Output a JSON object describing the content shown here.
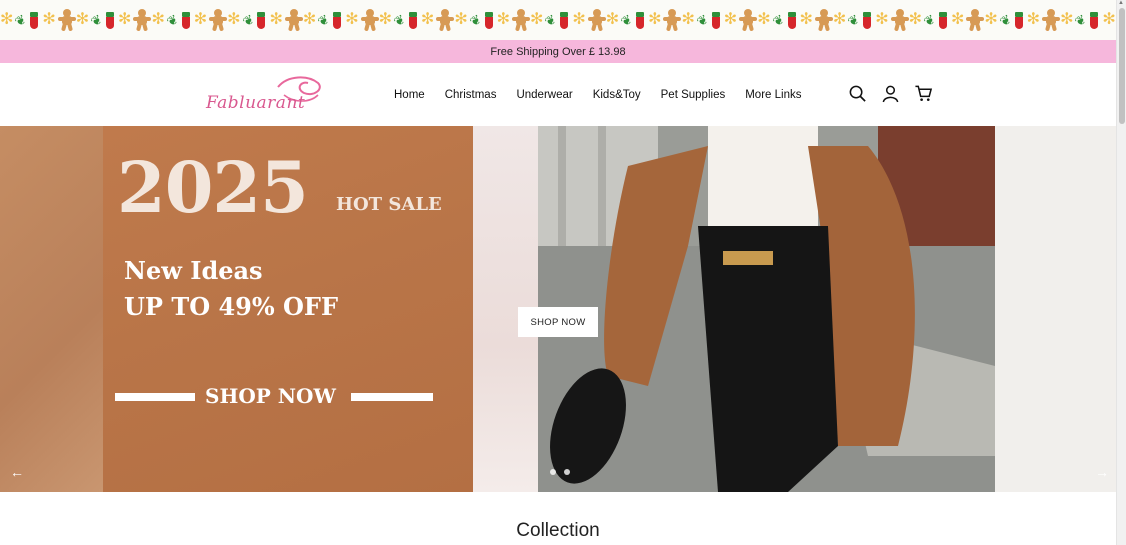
{
  "announcement": {
    "text": "Free Shipping Over £ 13.98"
  },
  "brand": {
    "name": "Fabluarant",
    "color": "#d9588f"
  },
  "nav": {
    "items": [
      "Home",
      "Christmas",
      "Underwear",
      "Kids&Toy",
      "Pet Supplies",
      "More Links"
    ]
  },
  "header_icons": [
    "search-icon",
    "account-icon",
    "cart-icon"
  ],
  "hero": {
    "year": "2025",
    "hot_sale": "HOT SALE",
    "line1": "New Ideas",
    "line2": "UP TO 49% OFF",
    "promo_cta": "SHOP NOW",
    "shop_button": "SHOP NOW",
    "prev_arrow": "←",
    "next_arrow": "→",
    "promo_color": "#b97548"
  },
  "collection": {
    "title": "Collection"
  },
  "colors": {
    "announcement_bg": "#f6b7dc"
  }
}
